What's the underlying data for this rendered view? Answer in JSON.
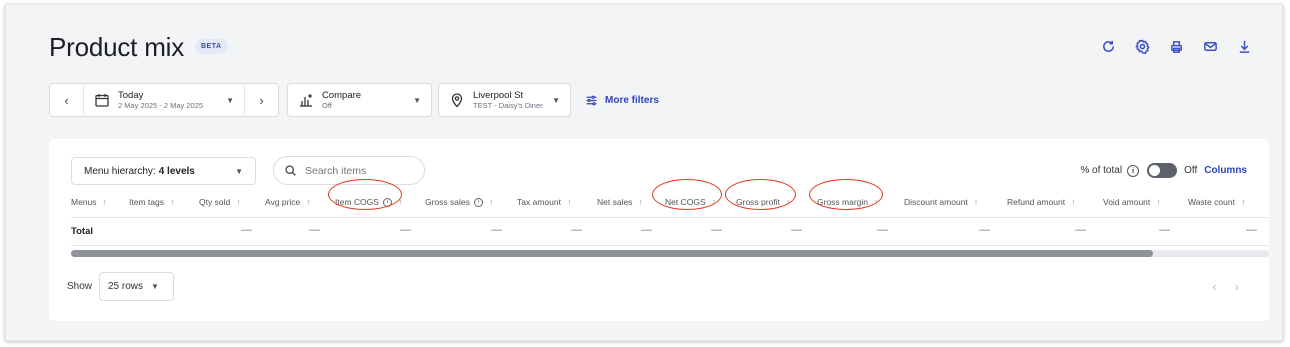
{
  "page": {
    "title": "Product mix",
    "badge": "BETA"
  },
  "toolbar_icons": [
    "refresh-icon",
    "settings-icon",
    "print-icon",
    "mail-icon",
    "download-icon"
  ],
  "filters": {
    "prev_label": "‹",
    "next_label": "›",
    "date": {
      "main": "Today",
      "sub": "2 May 2025 - 2 May 2025"
    },
    "compare": {
      "main": "Compare",
      "sub": "Off"
    },
    "location": {
      "main": "Liverpool St",
      "sub": "TEST - Daisy's Diner"
    },
    "more_filters": "More filters"
  },
  "table_controls": {
    "hierarchy_prefix": "Menu hierarchy:",
    "hierarchy_value": "4 levels",
    "search_placeholder": "Search items",
    "pct_total_label": "% of total",
    "toggle_state": "Off",
    "columns_label": "Columns"
  },
  "columns": [
    "Menus",
    "Item tags",
    "Qty sold",
    "Avg price",
    "Item COGS",
    "Gross sales",
    "Tax amount",
    "Net sales",
    "Net COGS",
    "Gross profit",
    "Gross margin",
    "Discount amount",
    "Refund amount",
    "Void amount",
    "Waste count"
  ],
  "sort_arrow": "↑",
  "info_glyph": "i",
  "total_row": {
    "label": "Total",
    "dash": "—"
  },
  "pagination": {
    "show_label": "Show",
    "rows_value": "25 rows",
    "prev": "‹",
    "next": "›"
  },
  "accent_color": "#2e44b8",
  "annotation_color": "#e03a1e"
}
